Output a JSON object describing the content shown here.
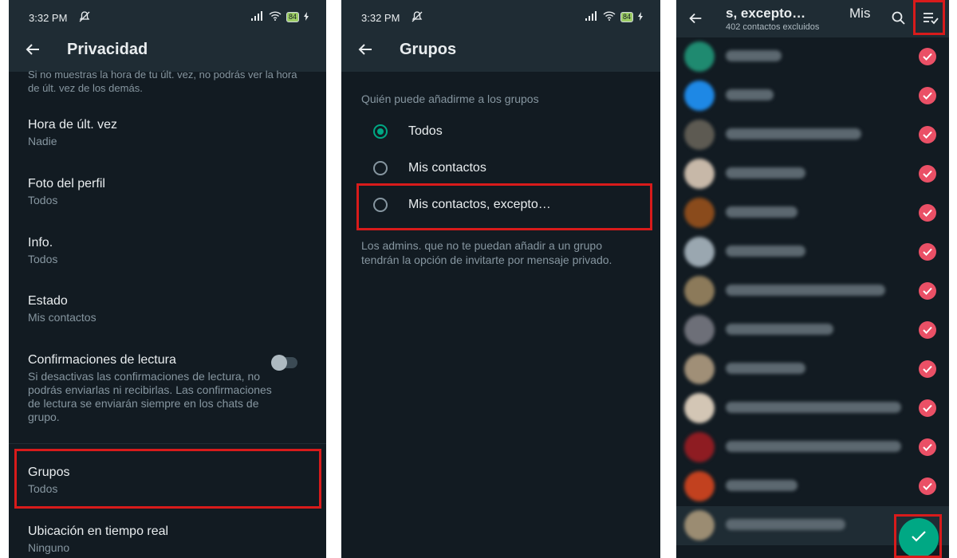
{
  "status": {
    "time": "3:32 PM",
    "battery": "84"
  },
  "privacy": {
    "title": "Privacidad",
    "truncated_note": "Si no muestras la hora de tu últ. vez, no podrás ver la hora de últ. vez de los demás.",
    "items": [
      {
        "title": "Hora de últ. vez",
        "value": "Nadie"
      },
      {
        "title": "Foto del perfil",
        "value": "Todos"
      },
      {
        "title": "Info.",
        "value": "Todos"
      },
      {
        "title": "Estado",
        "value": "Mis contactos"
      }
    ],
    "read_receipts": {
      "title": "Confirmaciones de lectura",
      "description": "Si desactivas las confirmaciones de lectura, no podrás enviarlas ni recibirlas. Las confirmaciones de lectura se enviarán siempre en los chats de grupo.",
      "enabled": false
    },
    "groups": {
      "title": "Grupos",
      "value": "Todos"
    },
    "live_location": {
      "title": "Ubicación en tiempo real",
      "value": "Ninguno"
    }
  },
  "groups_screen": {
    "title": "Grupos",
    "section_label": "Quién puede añadirme a los grupos",
    "options": [
      "Todos",
      "Mis contactos",
      "Mis contactos, excepto…"
    ],
    "selected_index": 0,
    "footer": "Los admins. que no te puedan añadir a un grupo tendrán la opción de invitarte por mensaje privado."
  },
  "except_screen": {
    "title": "s, excepto…",
    "title_fragment": "Mis",
    "subtitle": "402 contactos excluidos",
    "contact_count_visible": 13
  },
  "icons": {
    "back": "arrow-left-icon",
    "search": "search-icon",
    "select_all": "select-all-icon",
    "confirm": "check-icon",
    "mute": "mute-icon",
    "signal": "signal-icon",
    "wifi": "wifi-icon",
    "charging": "charging-icon"
  },
  "colors": {
    "background": "#121b22",
    "header": "#1f2c34",
    "accent": "#00a884",
    "check_red": "#ea5066",
    "highlight": "#d81b1b",
    "text_primary": "#e9edef",
    "text_secondary": "#8696a0"
  }
}
